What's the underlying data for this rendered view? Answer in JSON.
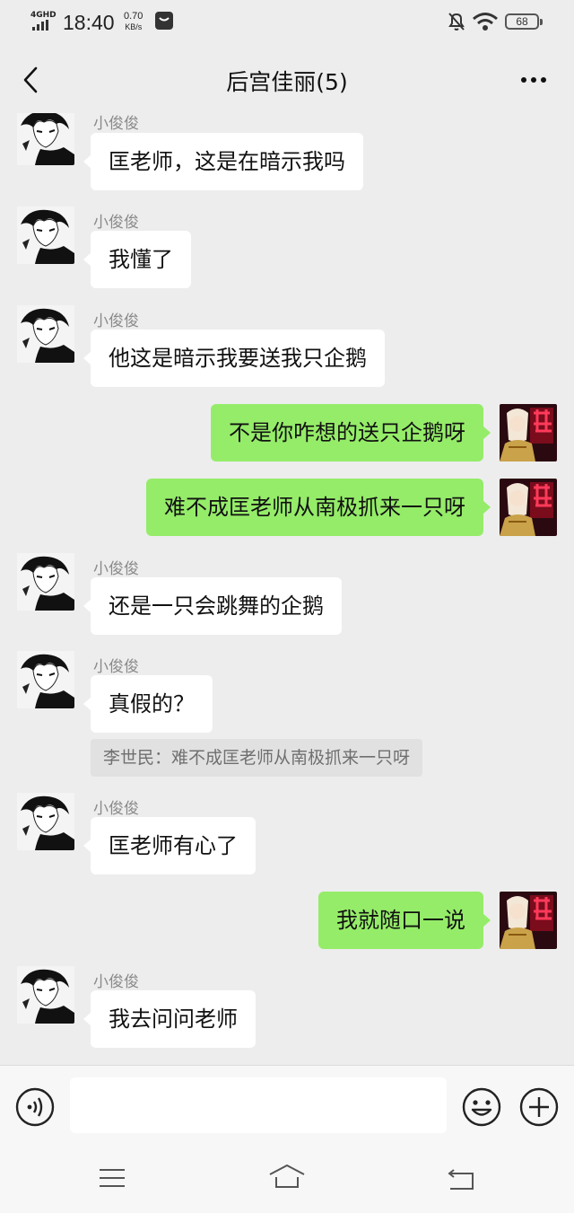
{
  "status_bar": {
    "network": "4GHD",
    "time": "18:40",
    "speed_value": "0.70",
    "speed_unit": "KB/s",
    "battery": "68"
  },
  "nav": {
    "title": "后宫佳丽(5)",
    "back_icon": "chevron-left-icon",
    "more_icon": "more-dots-icon"
  },
  "colors": {
    "background": "#ededed",
    "bubble_in": "#ffffff",
    "bubble_out": "#95ec69",
    "sender_name": "#8a8a8a"
  },
  "messages": [
    {
      "side": "in",
      "sender": "小俊俊",
      "text": "匡老师，这是在暗示我吗"
    },
    {
      "side": "in",
      "sender": "小俊俊",
      "text": "我懂了"
    },
    {
      "side": "in",
      "sender": "小俊俊",
      "text": "他这是暗示我要送我只企鹅"
    },
    {
      "side": "out",
      "text": "不是你咋想的送只企鹅呀"
    },
    {
      "side": "out",
      "text": "难不成匡老师从南极抓来一只呀"
    },
    {
      "side": "in",
      "sender": "小俊俊",
      "text": "还是一只会跳舞的企鹅"
    },
    {
      "side": "in",
      "sender": "小俊俊",
      "text": "真假的？",
      "quote": "李世民：难不成匡老师从南极抓来一只呀"
    },
    {
      "side": "in",
      "sender": "小俊俊",
      "text": "匡老师有心了"
    },
    {
      "side": "out",
      "text": "我就随口一说"
    },
    {
      "side": "in",
      "sender": "小俊俊",
      "text": "我去问问老师"
    }
  ],
  "input_bar": {
    "voice_icon": "voice-icon",
    "placeholder": "",
    "emoji_icon": "emoji-icon",
    "plus_icon": "plus-icon"
  },
  "system_nav": {
    "menu_icon": "menu-icon",
    "home_icon": "home-icon",
    "back_icon": "back-arrow-icon"
  }
}
